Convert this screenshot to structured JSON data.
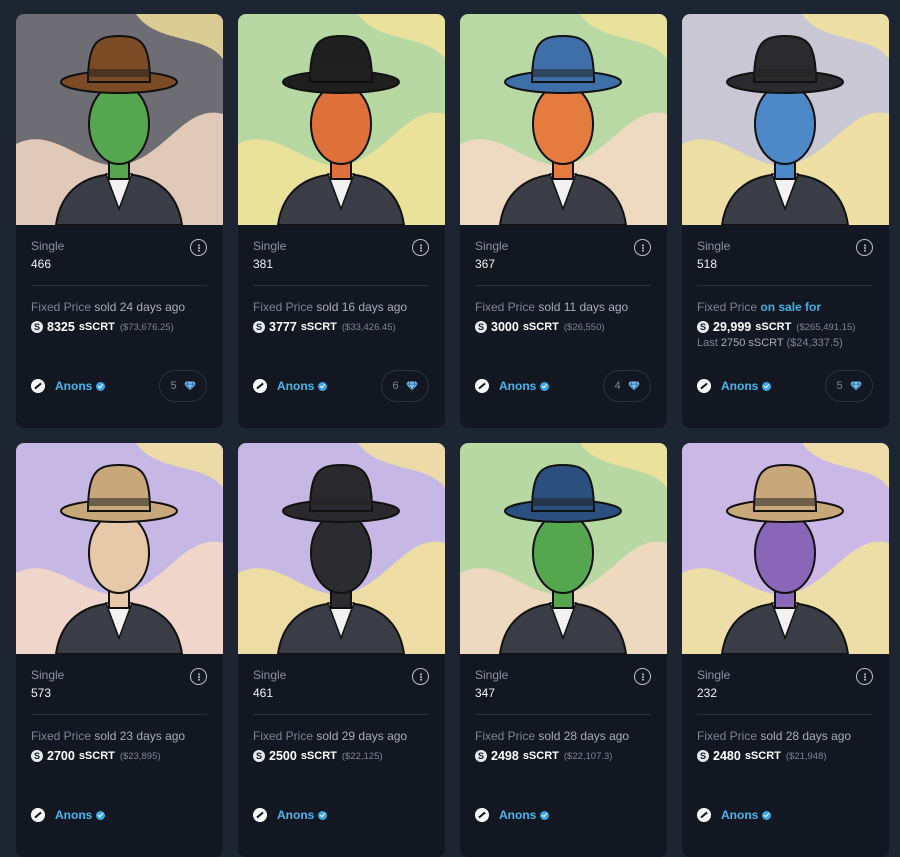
{
  "cards": [
    {
      "edition": "Single",
      "number": "466",
      "price_type": "Fixed Price",
      "status": "sold 24 days ago",
      "coin_symbol": "S",
      "amount": "8325",
      "unit": "sSCRT",
      "usd": "($73,676.25)",
      "collection": "Anons",
      "likes": "5",
      "bg": "#6f6d74",
      "skin": "#56a64f",
      "hat": "#7a4b24"
    },
    {
      "edition": "Single",
      "number": "381",
      "price_type": "Fixed Price",
      "status": "sold 16 days ago",
      "coin_symbol": "S",
      "amount": "3777",
      "unit": "sSCRT",
      "usd": "($33,426.45)",
      "collection": "Anons",
      "likes": "6",
      "bg": "#b7d7a3",
      "skin": "#e0703a",
      "hat": "#1f1f1f"
    },
    {
      "edition": "Single",
      "number": "367",
      "price_type": "Fixed Price",
      "status": "sold 11 days ago",
      "coin_symbol": "S",
      "amount": "3000",
      "unit": "sSCRT",
      "usd": "($26,550)",
      "collection": "Anons",
      "likes": "4",
      "bg": "#b9d9a4",
      "skin": "#e47c3f",
      "hat": "#3f6fa8"
    },
    {
      "edition": "Single",
      "number": "518",
      "price_type": "Fixed Price",
      "status": "on sale for",
      "coin_symbol": "S",
      "amount": "29,999",
      "unit": "sSCRT",
      "usd": "($265,491.15)",
      "last_label": "Last",
      "last_amount": "2750",
      "last_unit": "sSCRT",
      "last_usd": "($24,337.5)",
      "collection": "Anons",
      "likes": "5",
      "bg": "#c9c7d3",
      "skin": "#4d89c9",
      "hat": "#2b2b2e"
    },
    {
      "edition": "Single",
      "number": "573",
      "price_type": "Fixed Price",
      "status": "sold 23 days ago",
      "coin_symbol": "S",
      "amount": "2700",
      "unit": "sSCRT",
      "usd": "($23,895)",
      "collection": "Anons",
      "likes": "",
      "bg": "#c6b8e4",
      "skin": "#e7c9a9",
      "hat": "#c8a77a"
    },
    {
      "edition": "Single",
      "number": "461",
      "price_type": "Fixed Price",
      "status": "sold 29 days ago",
      "coin_symbol": "S",
      "amount": "2500",
      "unit": "sSCRT",
      "usd": "($22,125)",
      "collection": "Anons",
      "likes": "",
      "bg": "#c6b8e4",
      "skin": "#2c2b30",
      "hat": "#2a2a2e"
    },
    {
      "edition": "Single",
      "number": "347",
      "price_type": "Fixed Price",
      "status": "sold 28 days ago",
      "coin_symbol": "S",
      "amount": "2498",
      "unit": "sSCRT",
      "usd": "($22,107.3)",
      "collection": "Anons",
      "likes": "",
      "bg": "#b7d7a3",
      "skin": "#56a64f",
      "hat": "#2b4f7e"
    },
    {
      "edition": "Single",
      "number": "232",
      "price_type": "Fixed Price",
      "status": "sold 28 days ago",
      "coin_symbol": "S",
      "amount": "2480",
      "unit": "sSCRT",
      "usd": "($21,948)",
      "collection": "Anons",
      "likes": "",
      "bg": "#cbb8e6",
      "skin": "#8a66b8",
      "hat": "#c8a77a"
    }
  ],
  "icons": {
    "more": "more-vertical-icon",
    "coin": "secret-coin-icon",
    "verified": "verified-badge-icon",
    "gem": "diamond-icon",
    "collection_logo": "anons-logo-icon"
  }
}
